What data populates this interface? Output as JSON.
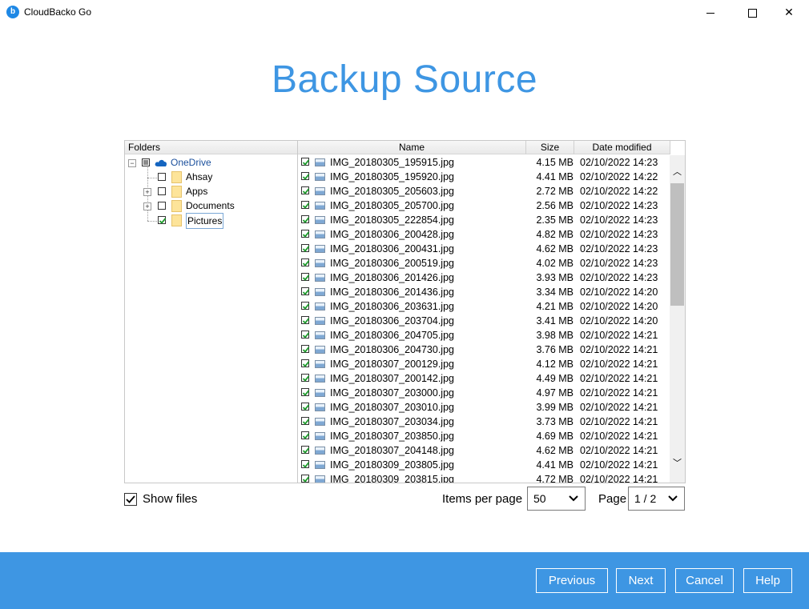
{
  "window": {
    "title": "CloudBacko Go",
    "icon": "cloudbacko-logo-icon"
  },
  "page": {
    "title": "Backup Source"
  },
  "folders": {
    "header": "Folders",
    "root": {
      "label": "OneDrive",
      "state": "partial",
      "expanded": true
    },
    "children": [
      {
        "label": "Ahsay",
        "checked": false,
        "expandable": false
      },
      {
        "label": "Apps",
        "checked": false,
        "expandable": true
      },
      {
        "label": "Documents",
        "checked": false,
        "expandable": true
      },
      {
        "label": "Pictures",
        "checked": true,
        "expandable": false,
        "selected": true
      }
    ]
  },
  "files": {
    "columns": {
      "name": "Name",
      "size": "Size",
      "date": "Date modified"
    },
    "rows": [
      {
        "name": "IMG_20180305_195915.jpg",
        "size": "4.15 MB",
        "date": "02/10/2022 14:23"
      },
      {
        "name": "IMG_20180305_195920.jpg",
        "size": "4.41 MB",
        "date": "02/10/2022 14:22"
      },
      {
        "name": "IMG_20180305_205603.jpg",
        "size": "2.72 MB",
        "date": "02/10/2022 14:22"
      },
      {
        "name": "IMG_20180305_205700.jpg",
        "size": "2.56 MB",
        "date": "02/10/2022 14:23"
      },
      {
        "name": "IMG_20180305_222854.jpg",
        "size": "2.35 MB",
        "date": "02/10/2022 14:23"
      },
      {
        "name": "IMG_20180306_200428.jpg",
        "size": "4.82 MB",
        "date": "02/10/2022 14:23"
      },
      {
        "name": "IMG_20180306_200431.jpg",
        "size": "4.62 MB",
        "date": "02/10/2022 14:23"
      },
      {
        "name": "IMG_20180306_200519.jpg",
        "size": "4.02 MB",
        "date": "02/10/2022 14:23"
      },
      {
        "name": "IMG_20180306_201426.jpg",
        "size": "3.93 MB",
        "date": "02/10/2022 14:23"
      },
      {
        "name": "IMG_20180306_201436.jpg",
        "size": "3.34 MB",
        "date": "02/10/2022 14:20"
      },
      {
        "name": "IMG_20180306_203631.jpg",
        "size": "4.21 MB",
        "date": "02/10/2022 14:20"
      },
      {
        "name": "IMG_20180306_203704.jpg",
        "size": "3.41 MB",
        "date": "02/10/2022 14:20"
      },
      {
        "name": "IMG_20180306_204705.jpg",
        "size": "3.98 MB",
        "date": "02/10/2022 14:21"
      },
      {
        "name": "IMG_20180306_204730.jpg",
        "size": "3.76 MB",
        "date": "02/10/2022 14:21"
      },
      {
        "name": "IMG_20180307_200129.jpg",
        "size": "4.12 MB",
        "date": "02/10/2022 14:21"
      },
      {
        "name": "IMG_20180307_200142.jpg",
        "size": "4.49 MB",
        "date": "02/10/2022 14:21"
      },
      {
        "name": "IMG_20180307_203000.jpg",
        "size": "4.97 MB",
        "date": "02/10/2022 14:21"
      },
      {
        "name": "IMG_20180307_203010.jpg",
        "size": "3.99 MB",
        "date": "02/10/2022 14:21"
      },
      {
        "name": "IMG_20180307_203034.jpg",
        "size": "3.73 MB",
        "date": "02/10/2022 14:21"
      },
      {
        "name": "IMG_20180307_203850.jpg",
        "size": "4.69 MB",
        "date": "02/10/2022 14:21"
      },
      {
        "name": "IMG_20180307_204148.jpg",
        "size": "4.62 MB",
        "date": "02/10/2022 14:21"
      },
      {
        "name": "IMG_20180309_203805.jpg",
        "size": "4.41 MB",
        "date": "02/10/2022 14:21"
      },
      {
        "name": "IMG_20180309_203815.jpg",
        "size": "4.72 MB",
        "date": "02/10/2022 14:21"
      }
    ]
  },
  "options": {
    "show_files_label": "Show files",
    "show_files_checked": true,
    "items_per_page_label": "Items per page",
    "items_per_page_value": "50",
    "page_label": "Page",
    "page_value": "1 / 2"
  },
  "footer": {
    "previous": "Previous",
    "next": "Next",
    "cancel": "Cancel",
    "help": "Help"
  },
  "colors": {
    "accent": "#3e96e3",
    "check": "#1e9b2c"
  }
}
